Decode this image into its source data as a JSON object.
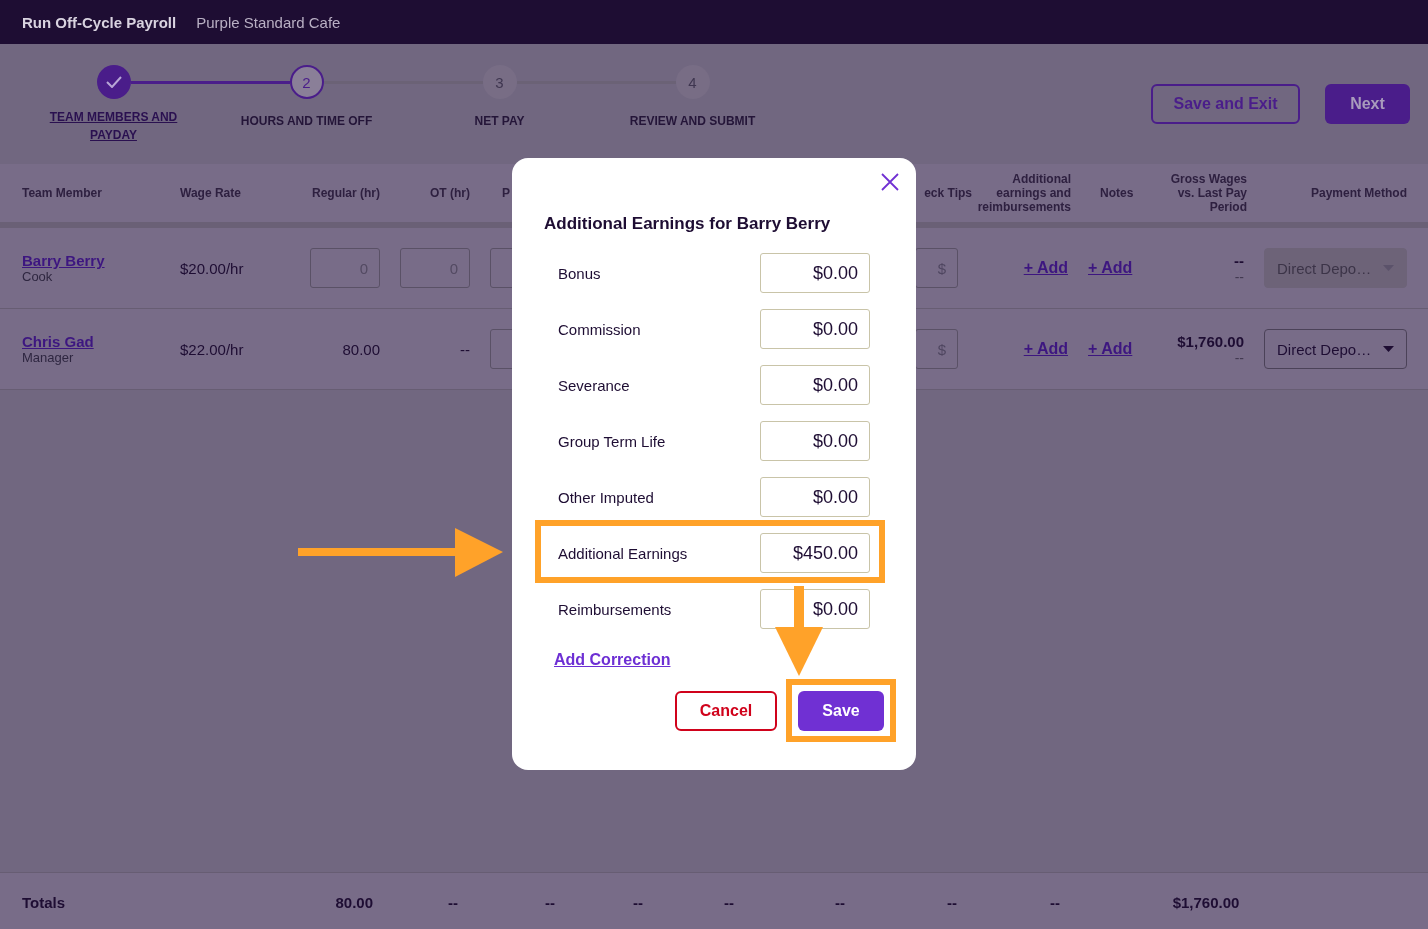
{
  "header": {
    "title": "Run Off-Cycle Payroll",
    "company": "Purple Standard Cafe"
  },
  "stepper": [
    {
      "label": "TEAM MEMBERS AND PAYDAY",
      "completed": true,
      "current": false
    },
    {
      "number": "2",
      "label": "HOURS AND TIME OFF",
      "completed": false,
      "current": true
    },
    {
      "number": "3",
      "label": "NET PAY",
      "completed": false,
      "current": false
    },
    {
      "number": "4",
      "label": "REVIEW AND SUBMIT",
      "completed": false,
      "current": false
    }
  ],
  "actions": {
    "save_exit": "Save and Exit",
    "next": "Next"
  },
  "table": {
    "columns": [
      "Team Member",
      "Wage Rate",
      "Regular (hr)",
      "OT (hr)",
      "P",
      "eck Tips",
      "Additional earnings and reimbursements",
      "Notes",
      "Gross Wages vs. Last Pay Period",
      "Payment Method"
    ],
    "rows": [
      {
        "name": "Barry Berry",
        "role": "Cook",
        "wage": "$20.00/hr",
        "regular": {
          "kind": "input",
          "placeholder": "0"
        },
        "ot": {
          "kind": "input",
          "placeholder": "0"
        },
        "tips_prefix": "$",
        "additional": "+ Add",
        "notes": "+ Add",
        "gross": "--",
        "gross_change": "--",
        "payment": "Direct Depo…",
        "payment_disabled": true
      },
      {
        "name": "Chris Gad",
        "role": "Manager",
        "wage": "$22.00/hr",
        "regular": {
          "kind": "text",
          "value": "80.00"
        },
        "ot": {
          "kind": "text",
          "value": "--"
        },
        "tips_prefix": "$",
        "additional": "+ Add",
        "notes": "+ Add",
        "gross": "$1,760.00",
        "gross_change": "--",
        "payment": "Direct Depo…",
        "payment_disabled": false
      }
    ],
    "totals": {
      "label": "Totals",
      "values": [
        "80.00",
        "--",
        "--",
        "--",
        "--",
        "--",
        "--",
        "--",
        "$1,760.00"
      ]
    }
  },
  "modal": {
    "title": "Additional Earnings for Barry Berry",
    "fields": [
      {
        "label": "Bonus",
        "value": "$0.00",
        "highlighted": false
      },
      {
        "label": "Commission",
        "value": "$0.00",
        "highlighted": false
      },
      {
        "label": "Severance",
        "value": "$0.00",
        "highlighted": false
      },
      {
        "label": "Group Term Life",
        "value": "$0.00",
        "highlighted": false
      },
      {
        "label": "Other Imputed",
        "value": "$0.00",
        "highlighted": false
      },
      {
        "label": "Additional Earnings",
        "value": "$450.00",
        "highlighted": true
      },
      {
        "label": "Reimbursements",
        "value": "$0.00",
        "highlighted": false
      }
    ],
    "add_correction": "Add Correction",
    "cancel": "Cancel",
    "save": "Save",
    "save_highlighted": true
  }
}
